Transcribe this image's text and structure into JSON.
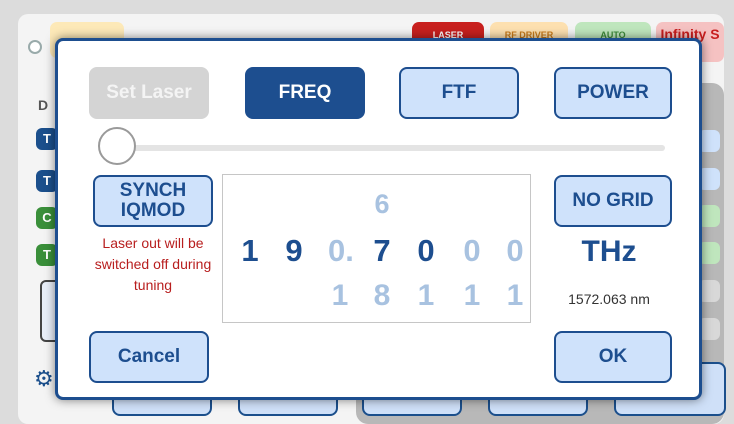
{
  "background": {
    "label_d": "D",
    "pills": {
      "laser": "LASER",
      "rf_driver": "RF DRIVER",
      "auto": "AUTO",
      "infinity": "Infinity S"
    },
    "tags": [
      "T",
      "T",
      "C",
      "T"
    ]
  },
  "dialog": {
    "set_laser_label": "Set Laser",
    "tabs": {
      "freq": "FREQ",
      "ftf": "FTF",
      "power": "POWER"
    },
    "synch_label": "SYNCH IQMOD",
    "warning_text": "Laser out will be switched off during tuning",
    "no_grid_label": "NO GRID",
    "picker": {
      "main": [
        "1",
        "9",
        "0.",
        "7",
        "0",
        "0",
        "0"
      ],
      "above": [
        "",
        "",
        "",
        "6",
        "",
        "",
        ""
      ],
      "below": [
        "",
        "",
        "1",
        "8",
        "1",
        "1",
        "1"
      ]
    },
    "unit": "THz",
    "wavelength": "1572.063 nm",
    "cancel_label": "Cancel",
    "ok_label": "OK"
  },
  "slider": {
    "position_fraction": 0.0
  },
  "colors": {
    "primary": "#1d4e8f",
    "button_fill": "#cfe2fb",
    "warning": "#b81e1e",
    "pale_digit": "#a8c2e0"
  }
}
